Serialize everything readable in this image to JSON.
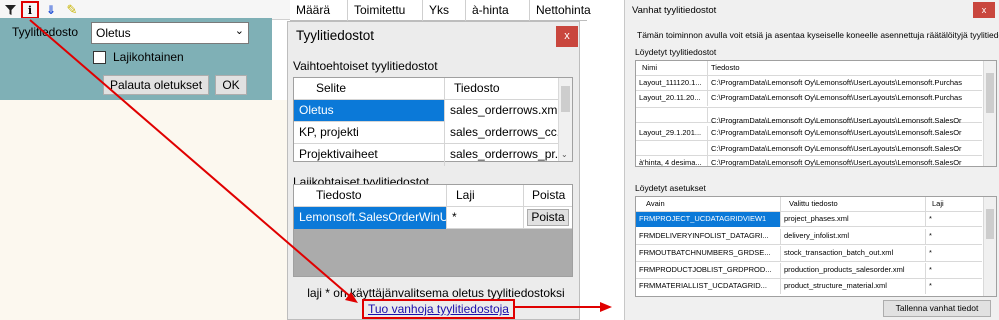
{
  "toolbar": {
    "icons": [
      "funnel-icon",
      "info-icon",
      "sort-down-icon",
      "pencil-icon"
    ]
  },
  "grid_header": [
    "Määrä",
    "Toimitettu",
    "Yks",
    "à-hinta",
    "Nettohinta"
  ],
  "style_panel": {
    "label": "Tyylitiedosto",
    "selected": "Oletus",
    "checkbox_label": "Lajikohtainen",
    "reset_button": "Palauta oletukset",
    "ok_button": "OK"
  },
  "styles_dialog": {
    "title": "Tyylitiedostot",
    "close": "x",
    "alt_section": "Vaihtoehtoiset tyylitiedostot",
    "alt_columns": [
      "Selite",
      "Tiedosto"
    ],
    "alt_rows": [
      [
        "Oletus",
        "sales_orderrows.xml"
      ],
      [
        "KP, projekti",
        "sales_orderrows_cc..."
      ],
      [
        "Projektivaiheet",
        "sales_orderrows_pr..."
      ]
    ],
    "type_section": "Lajikohtaiset tyylitiedostot",
    "type_columns": [
      "Tiedosto",
      "Laji",
      "Poista"
    ],
    "type_rows": [
      [
        "Lemonsoft.SalesOrderWinU...",
        "*",
        "Poista"
      ]
    ],
    "note": "laji * on käyttäjänvalitsema oletus tyylitiedostoksi",
    "link": "Tuo vanhoja tyylitiedostoja"
  },
  "old_dialog": {
    "title": "Vanhat tyylitiedostot",
    "close": "x",
    "description": "Tämän toiminnon avulla voit etsiä ja asentaa kyseiselle koneelle asennettuja räätälöityjä tyylitiedostoja.",
    "found_files_label": "Löydetyt tyylitiedostot",
    "files_columns": [
      "Nimi",
      "Tiedosto"
    ],
    "files_rows": [
      [
        "Layout_111120.1...",
        "C:\\ProgramData\\Lemonsoft Oy\\Lemonsoft\\UserLayouts\\Lemonsoft.Purchas"
      ],
      [
        "Layout_20.11.20...",
        "C:\\ProgramData\\Lemonsoft Oy\\Lemonsoft\\UserLayouts\\Lemonsoft.Purchas"
      ],
      [
        "",
        "C:\\ProgramData\\Lemonsoft Oy\\Lemonsoft\\UserLayouts\\Lemonsoft.SalesOr"
      ],
      [
        "Layout_29.1.201...",
        "C:\\ProgramData\\Lemonsoft Oy\\Lemonsoft\\UserLayouts\\Lemonsoft.SalesOr"
      ],
      [
        "",
        "C:\\ProgramData\\Lemonsoft Oy\\Lemonsoft\\UserLayouts\\Lemonsoft.SalesOr"
      ],
      [
        "à'hinta, 4 desima...",
        "C:\\ProgramData\\Lemonsoft Oy\\Lemonsoft\\UserLayouts\\Lemonsoft.SalesOr"
      ]
    ],
    "found_settings_label": "Löydetyt asetukset",
    "settings_columns": [
      "Avain",
      "Valittu tiedosto",
      "Laji"
    ],
    "settings_rows": [
      [
        "FRMPROJECT_UCDATAGRIDVIEW1",
        "project_phases.xml",
        "*"
      ],
      [
        "FRMDELIVERYINFOLIST_DATAGRI...",
        "delivery_infolist.xml",
        "*"
      ],
      [
        "FRMOUTBATCHNUMBERS_GRDSE...",
        "stock_transaction_batch_out.xml",
        "*"
      ],
      [
        "FRMPRODUCTJOBLIST_GRDPROD...",
        "production_products_salesorder.xml",
        "*"
      ],
      [
        "FRMMATERIALLIST_UCDATAGRID...",
        "product_structure_material.xml",
        "*"
      ]
    ],
    "save_button": "Tallenna vanhat tiedot"
  },
  "colors": {
    "panel": "#7fb0b6",
    "selection": "#0b79d8",
    "close": "#c9463d",
    "highlight": "#e00000"
  }
}
